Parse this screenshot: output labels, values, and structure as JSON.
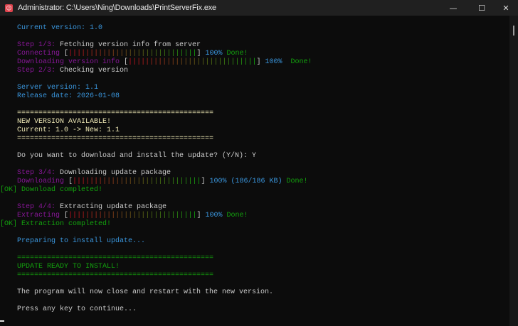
{
  "window": {
    "title": "Administrator: C:\\Users\\Ning\\Downloads\\PrintServerFix.exe",
    "icon": "terminal-app-icon",
    "minimize": "—",
    "maximize": "☐",
    "close": "✕"
  },
  "colors": {
    "w": "#cccccc",
    "c": "#3a96dd",
    "m": "#881798",
    "g": "#13a10e",
    "y": "#ede7b4",
    "r": "#c50f1f"
  },
  "lines": [
    [
      [
        "    Current version: 1.0",
        "c"
      ]
    ],
    [],
    [
      [
        "    Step 1/3: ",
        "m"
      ],
      [
        "Fetching version info from server",
        "w"
      ]
    ],
    [
      [
        "    Connecting ",
        "m"
      ],
      [
        "[",
        "w"
      ],
      {
        "bar": 100
      },
      [
        "] ",
        "w"
      ],
      [
        "100% ",
        "c"
      ],
      [
        "Done!",
        "g"
      ]
    ],
    [
      [
        "    Downloading version info ",
        "m"
      ],
      [
        "[",
        "w"
      ],
      {
        "bar": 100
      },
      [
        "] ",
        "w"
      ],
      [
        "100%  ",
        "c"
      ],
      [
        "Done!",
        "g"
      ]
    ],
    [
      [
        "    Step 2/3: ",
        "m"
      ],
      [
        "Checking version",
        "w"
      ]
    ],
    [],
    [
      [
        "    Server version: 1.1",
        "c"
      ]
    ],
    [
      [
        "    Release date: 2026-01-08",
        "c"
      ]
    ],
    [],
    [
      [
        "    ==============================================",
        "y"
      ]
    ],
    [
      [
        "    NEW VERSION AVAILABLE!",
        "y"
      ]
    ],
    [
      [
        "    Current: 1.0 -> New: 1.1",
        "y"
      ]
    ],
    [
      [
        "    ==============================================",
        "y"
      ]
    ],
    [],
    [
      [
        "    Do you want to download and install the update? (Y/N): Y",
        "w"
      ]
    ],
    [],
    [
      [
        "    Step 3/4: ",
        "m"
      ],
      [
        "Downloading update package",
        "w"
      ]
    ],
    [
      [
        "    Downloading ",
        "m"
      ],
      [
        "[",
        "w"
      ],
      {
        "bar": 100
      },
      [
        "] ",
        "w"
      ],
      [
        "100% (186/186 KB) ",
        "c"
      ],
      [
        "Done!",
        "g"
      ]
    ],
    [
      [
        "[OK] Download completed!",
        "g"
      ]
    ],
    [],
    [
      [
        "    Step 4/4: ",
        "m"
      ],
      [
        "Extracting update package",
        "w"
      ]
    ],
    [
      [
        "    Extracting ",
        "m"
      ],
      [
        "[",
        "w"
      ],
      {
        "bar": 100
      },
      [
        "] ",
        "w"
      ],
      [
        "100% ",
        "c"
      ],
      [
        "Done!",
        "g"
      ]
    ],
    [
      [
        "[OK] Extraction completed!",
        "g"
      ]
    ],
    [],
    [
      [
        "    Preparing to install update...",
        "c"
      ]
    ],
    [],
    [
      [
        "    ==============================================",
        "g"
      ]
    ],
    [
      [
        "    UPDATE READY TO INSTALL!",
        "g"
      ]
    ],
    [
      [
        "    ==============================================",
        "g"
      ]
    ],
    [],
    [
      [
        "    The program will now close and restart with the new version.",
        "w"
      ]
    ],
    [],
    [
      [
        "    Press any key to continue...",
        "w"
      ]
    ]
  ]
}
